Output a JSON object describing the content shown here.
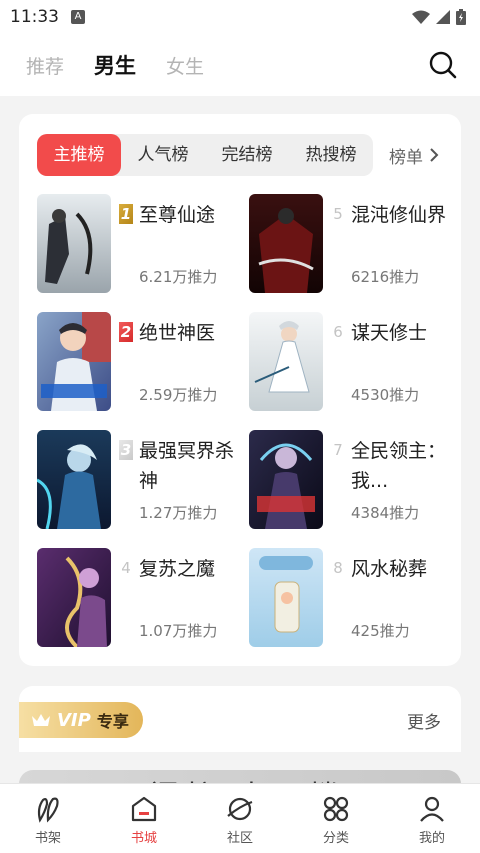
{
  "status": {
    "time": "11:33",
    "notif": "A"
  },
  "top_tabs": [
    {
      "label": "推荐",
      "active": false
    },
    {
      "label": "男生",
      "active": true
    },
    {
      "label": "女生",
      "active": false
    }
  ],
  "rank_tabs": [
    {
      "label": "主推榜",
      "active": true
    },
    {
      "label": "人气榜",
      "active": false
    },
    {
      "label": "完结榜",
      "active": false
    },
    {
      "label": "热搜榜",
      "active": false
    }
  ],
  "rank_more": "榜单",
  "books": [
    {
      "rank": "1",
      "title": "至尊仙途",
      "popularity": "6.21万推力"
    },
    {
      "rank": "2",
      "title": "绝世神医",
      "popularity": "2.59万推力"
    },
    {
      "rank": "3",
      "title": "最强冥界杀神",
      "popularity": "1.27万推力"
    },
    {
      "rank": "4",
      "title": "复苏之魔",
      "popularity": "1.07万推力"
    },
    {
      "rank": "5",
      "title": "混沌修仙界",
      "popularity": "6216推力"
    },
    {
      "rank": "6",
      "title": "谋天修士",
      "popularity": "4530推力"
    },
    {
      "rank": "7",
      "title": "全民领主：我...",
      "popularity": "4384推力"
    },
    {
      "rank": "8",
      "title": "风水秘葬",
      "popularity": "425推力"
    }
  ],
  "vip": {
    "badge": "VIP",
    "subtitle": "专享",
    "more": "更多"
  },
  "banner_partial_text": "无门柱 中层楼下",
  "bottom_nav": [
    {
      "label": "书架",
      "icon": "bookshelf-icon",
      "active": false
    },
    {
      "label": "书城",
      "icon": "bookstore-icon",
      "active": true
    },
    {
      "label": "社区",
      "icon": "planet-icon",
      "active": false
    },
    {
      "label": "分类",
      "icon": "category-icon",
      "active": false
    },
    {
      "label": "我的",
      "icon": "profile-icon",
      "active": false
    }
  ],
  "colors": {
    "accent": "#f24b4b",
    "gold": "#d9ad3c",
    "active_nav": "#e64141"
  }
}
